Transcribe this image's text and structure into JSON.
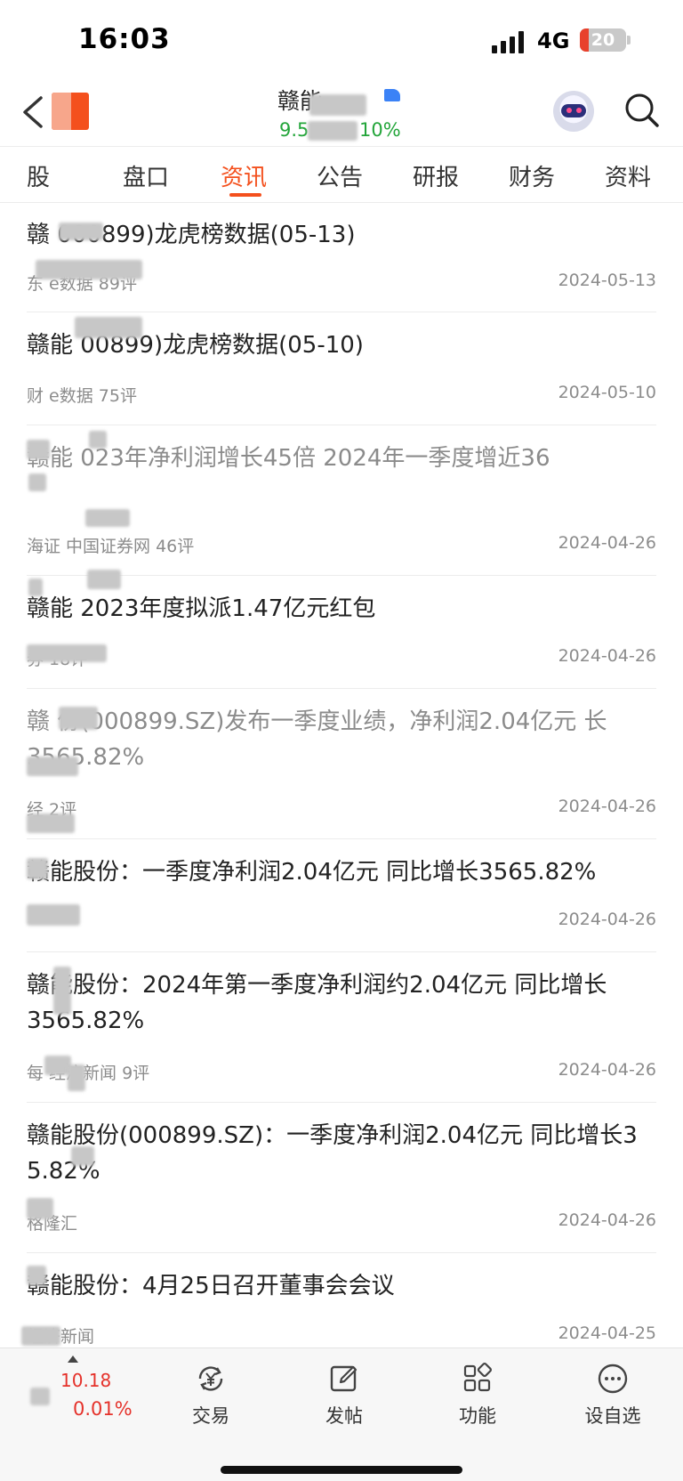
{
  "status_bar": {
    "time": "16:03",
    "network": "4G",
    "battery": "20",
    "battery_level": 0.2
  },
  "header": {
    "stock_name": "赣能",
    "price": "9.5",
    "change": "10%"
  },
  "tabs": [
    {
      "label": "股",
      "active": false
    },
    {
      "label": "盘口",
      "active": false
    },
    {
      "label": "资讯",
      "active": true
    },
    {
      "label": "公告",
      "active": false
    },
    {
      "label": "研报",
      "active": false
    },
    {
      "label": "财务",
      "active": false
    },
    {
      "label": "资料",
      "active": false
    }
  ],
  "news": [
    {
      "title": "赣  000899)龙虎榜数据(05-13)",
      "meta": "东 e数据  89评",
      "date": "2024-05-13",
      "read": false
    },
    {
      "title": "赣能  00899)龙虎榜数据(05-10)",
      "meta": "财  e数据  75评",
      "date": "2024-05-10",
      "read": false
    },
    {
      "title": "赣能  023年净利润增长45倍 2024年一季度增近36",
      "meta": "海证  中国证券网  46评",
      "date": "2024-04-26",
      "read": true
    },
    {
      "title": "赣能  2023年度拟派1.47亿元红包",
      "meta": "券  18评",
      "date": "2024-04-26",
      "read": false
    },
    {
      "title": "赣  份(000899.SZ)发布一季度业绩，净利润2.04亿元  长3565.82%",
      "meta": "经  2评",
      "date": "2024-04-26",
      "read": true
    },
    {
      "title": "赣能股份：一季度净利润2.04亿元 同比增长3565.82%",
      "meta": "",
      "date": "2024-04-26",
      "read": false
    },
    {
      "title": "赣能股份：2024年第一季度净利润约2.04亿元 同比增长3565.82%",
      "meta": "每  经济新闻  9评",
      "date": "2024-04-26",
      "read": false
    },
    {
      "title": "赣能股份(000899.SZ)：一季度净利润2.04亿元 同比增长3  5.82%",
      "meta": "格隆汇",
      "date": "2024-04-26",
      "read": false
    },
    {
      "title": "赣能股份：4月25日召开董事会会议",
      "meta": "  经济新闻",
      "date": "2024-04-25",
      "read": false
    }
  ],
  "bottom_bar": {
    "price": "10.18",
    "change": "0.01%",
    "buttons": [
      {
        "label": "交易",
        "icon": "trade-yen-icon"
      },
      {
        "label": "发帖",
        "icon": "compose-post-icon"
      },
      {
        "label": "功能",
        "icon": "function-grid-icon"
      },
      {
        "label": "设自选",
        "icon": "more-dots-icon"
      }
    ]
  },
  "colors": {
    "accent": "#f4501d",
    "up_green": "#23a53a",
    "down_red": "#e5322b",
    "read_gray": "#8b8b8b"
  }
}
